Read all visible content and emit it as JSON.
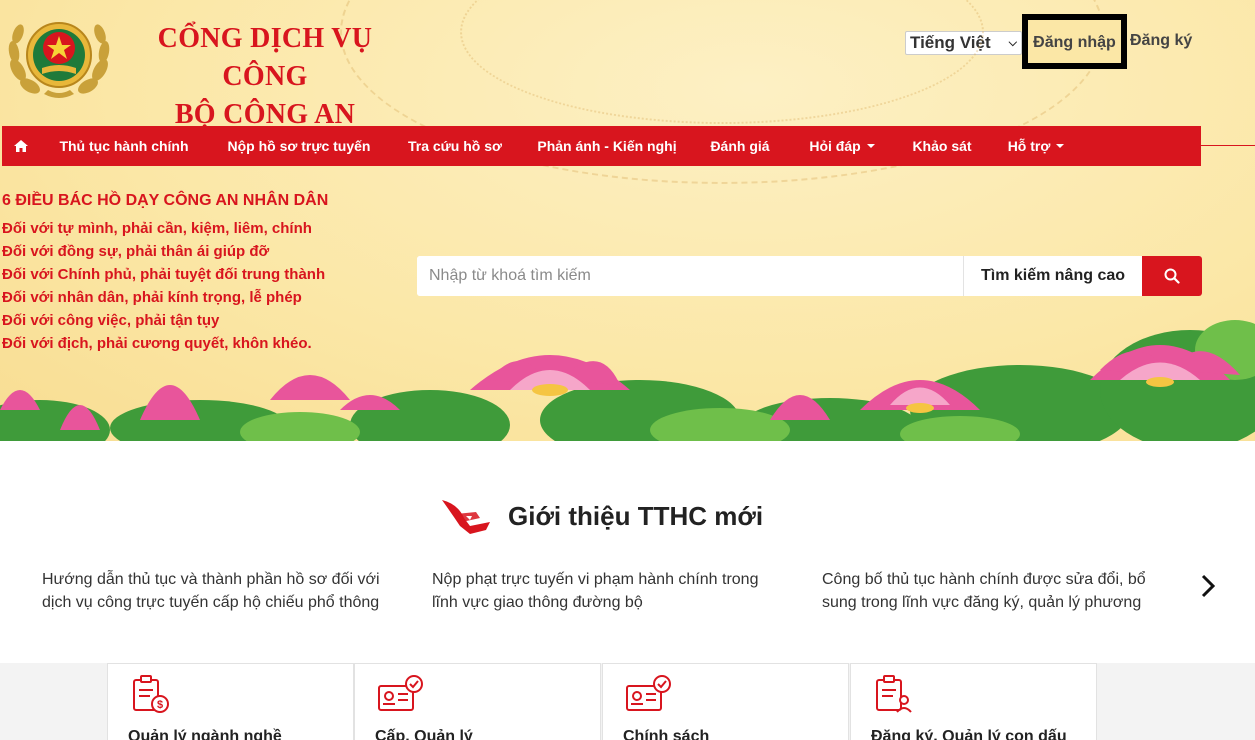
{
  "header": {
    "site_title_line1": "CỔNG DỊCH VỤ CÔNG",
    "site_title_line2": "BỘ CÔNG AN",
    "language": "Tiếng Việt",
    "login": "Đăng nhập",
    "register": "Đăng ký"
  },
  "nav": {
    "items": [
      {
        "label": "Thủ tục hành chính"
      },
      {
        "label": "Nộp hồ sơ trực tuyến"
      },
      {
        "label": "Tra cứu hồ sơ"
      },
      {
        "label": "Phản ánh - Kiến nghị"
      },
      {
        "label": "Đánh giá"
      },
      {
        "label": "Hỏi đáp"
      },
      {
        "label": "Khảo sát"
      },
      {
        "label": "Hỗ trợ"
      }
    ]
  },
  "teachings": {
    "title": "6 ĐIỀU BÁC HỒ DẠY CÔNG AN NHÂN DÂN",
    "lines": [
      "Đối với tự mình, phải cần, kiệm, liêm, chính",
      "Đối với đồng sự, phải thân ái giúp đỡ",
      "Đối với Chính phủ, phải tuyệt đối trung thành",
      "Đối với nhân dân, phải kính trọng, lễ phép",
      "Đối với công việc, phải tận tụy",
      "Đối với địch, phải cương quyết, khôn khéo."
    ]
  },
  "search": {
    "placeholder": "Nhập từ khoá tìm kiếm",
    "advanced": "Tìm kiếm nâng cao"
  },
  "tthc": {
    "title": "Giới thiệu TTHC mới",
    "items": [
      {
        "line1": "Hướng dẫn thủ tục và thành phần hồ sơ đối với",
        "line2": "dịch vụ công trực tuyến cấp hộ chiếu phổ thông"
      },
      {
        "line1": "Nộp phạt trực tuyến vi phạm hành chính trong",
        "line2": "lĩnh vực giao thông đường bộ"
      },
      {
        "line1": "Công bố thủ tục hành chính được sửa đổi, bổ",
        "line2": "sung trong lĩnh vực đăng ký, quản lý phương"
      }
    ]
  },
  "cards": [
    {
      "label": "Quản lý ngành nghề",
      "icon": "document-money-icon"
    },
    {
      "label": "Cấp, Quản lý",
      "icon": "id-card-check-icon"
    },
    {
      "label": "Chính sách",
      "icon": "id-card-check-icon"
    },
    {
      "label": "Đăng ký, Quản lý con dấu",
      "icon": "document-person-icon"
    }
  ],
  "colors": {
    "brand_red": "#d8151e",
    "banner_bg": "#fbe7a6"
  }
}
